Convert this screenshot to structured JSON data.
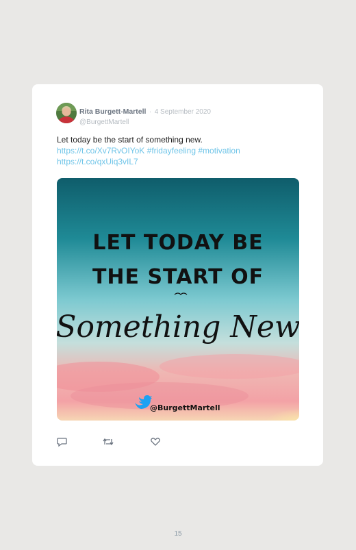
{
  "tweet": {
    "author": {
      "display_name": "Rita Burgett-Martell",
      "handle": "@BurgettMartell",
      "avatar_icon": "avatar-photo"
    },
    "separator": "·",
    "date": "4 September 2020",
    "text": "Let today be the start of something new.",
    "links": {
      "url1": "https://t.co/Xv7RvOIYoK",
      "hashtag1": "#fridayfeeling",
      "hashtag2": "#motivation",
      "url2": "https://t.co/qxUiq3vIL7"
    },
    "media": {
      "line1": "LET TODAY BE",
      "line2": "THE START OF",
      "script_text": "Something New",
      "watermark": "@BurgettMartell",
      "watermark_icon": "twitter-bird-icon"
    },
    "actions": [
      {
        "icon": "reply-icon"
      },
      {
        "icon": "retweet-icon"
      },
      {
        "icon": "like-icon"
      }
    ]
  },
  "page": {
    "number": "15"
  },
  "colors": {
    "background": "#e9e8e6",
    "card": "#ffffff",
    "link": "#6ec4e8",
    "name": "#6b7480",
    "muted": "#b6bcc2"
  }
}
